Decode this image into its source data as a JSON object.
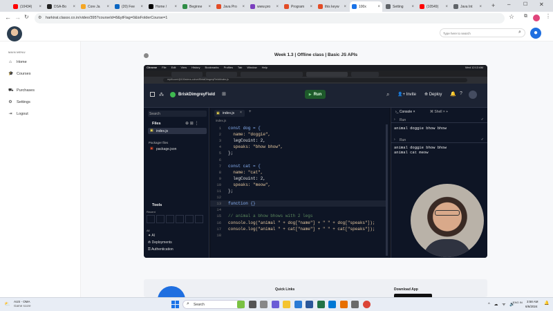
{
  "browser": {
    "tabs": [
      {
        "label": "(10434) ",
        "color": "#ff0000"
      },
      {
        "label": "DSA-Bo",
        "color": "#222222"
      },
      {
        "label": "Core Ja",
        "color": "#f5a623"
      },
      {
        "label": "(20) Fee",
        "color": "#0a66c2"
      },
      {
        "label": "Home /",
        "color": "#000000"
      },
      {
        "label": "Beginne",
        "color": "#2f8d46"
      },
      {
        "label": "Java Pro",
        "color": "#e34c26"
      },
      {
        "label": "www.pro",
        "color": "#7b3fbf"
      },
      {
        "label": "Program",
        "color": "#e34c26"
      },
      {
        "label": "this keyw",
        "color": "#e34c26"
      },
      {
        "label": "100x",
        "color": "#1a73e8",
        "active": true
      },
      {
        "label": "Setting",
        "color": "#5f6368"
      },
      {
        "label": "(10549)",
        "color": "#ff0000"
      },
      {
        "label": "Java Int",
        "color": "#5f6368"
      }
    ],
    "url": "harkirat.classx.co.in/video/395?courseId=8&ytFlag=0&isFolderCourse=1"
  },
  "app": {
    "search_placeholder": "Type here to search",
    "sidebar_heading": "MAIN MENU",
    "nav": [
      {
        "label": "Home",
        "icon": "home-icon",
        "glyph": "⌂"
      },
      {
        "label": "Courses",
        "icon": "graduation-cap-icon",
        "glyph": "🎓"
      },
      {
        "label": "Purchases",
        "icon": "purchases-icon",
        "glyph": "⛟"
      },
      {
        "label": "Settings",
        "icon": "gear-icon",
        "glyph": "⚙"
      },
      {
        "label": "Logout",
        "icon": "logout-icon",
        "glyph": "⇥"
      }
    ],
    "video_title": "Week 1.3 | Offline class | Basic JS APIs",
    "footer": {
      "quick_links": "Quick Links",
      "download_app": "Download App"
    }
  },
  "video": {
    "mac_menu": [
      "Chrome",
      "File",
      "Edit",
      "View",
      "History",
      "Bookmarks",
      "Profiles",
      "Tab",
      "Window",
      "Help"
    ],
    "clock": "Wed 12:13 AM",
    "inner_url": "replit.com/@100xdevs-cohort/BriskDimgreyField#index.js",
    "repl_name": "BriskDimgreyField",
    "run_label": "Run",
    "invite_label": "Invite",
    "deploy_label": "Deploy",
    "search_label": "Search",
    "files_label": "Files",
    "file_index": "index.js",
    "packager_label": "Packager files",
    "file_package": "package.json",
    "tools_label": "Tools",
    "recent_label": "Recent",
    "all_label": "All",
    "tool_ai": "AI",
    "tool_deployments": "Deployments",
    "tool_auth": "Authentication",
    "editor_tab": "index.js",
    "breadcrumb": "index.js",
    "console_tab": "Console",
    "shell_tab": "Shell",
    "code_lines": [
      "const dog = {",
      "  name: \"doggie\",",
      "  legCouint: 2,",
      "  speaks: \"bhow bhow\",",
      "};",
      "",
      "const cat = {",
      "  name: \"cat\",",
      "  legCouint: 2,",
      "  speaks: \"meow\",",
      "};",
      "",
      "function {}",
      "",
      "// animal a bhow bhows with 2 legs",
      "console.log(\"animal \" + dog[\"name\"] + \" \" + dog[\"speaks\"]);",
      "console.log(\"animal \" + cat[\"name\"] + \" \" + cat[\"speaks\"]);",
      ""
    ],
    "console_out_1": "animal doggie bhow bhow",
    "console_run_1": "Run",
    "console_run_2": "Run",
    "console_out_2a": "animal doggie bhow bhow",
    "console_out_2b": "animal cat meow"
  },
  "taskbar": {
    "weather_title": "AUS - OMA",
    "weather_sub": "Game score",
    "search_label": "Search",
    "lang": "ENG IN",
    "time": "3:58 AM",
    "date": "6/6/2024"
  }
}
